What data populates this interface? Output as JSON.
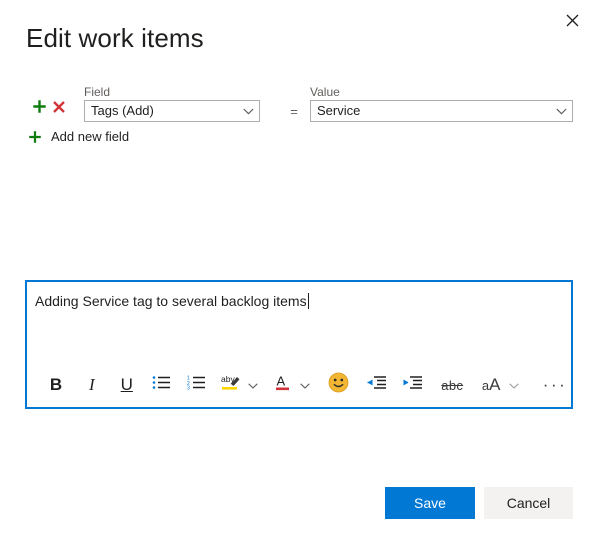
{
  "dialog": {
    "title": "Edit work items",
    "close_label": "Close"
  },
  "field_row": {
    "field_label": "Field",
    "value_label": "Value",
    "operator": "=",
    "field_selected": "Tags (Add)",
    "value_selected": "Service",
    "add_icon_name": "plus-icon",
    "remove_icon_name": "delete-icon"
  },
  "add_new_field": {
    "label": "Add new field"
  },
  "editor": {
    "text": "Adding Service tag to several backlog items",
    "toolbar": [
      {
        "name": "bold-icon",
        "label": "B",
        "kind": "bold"
      },
      {
        "name": "italic-icon",
        "label": "I",
        "kind": "italic"
      },
      {
        "name": "underline-icon",
        "label": "U",
        "kind": "underline"
      },
      {
        "name": "bulleted-list-icon",
        "label": "",
        "kind": "bullets"
      },
      {
        "name": "numbered-list-icon",
        "label": "",
        "kind": "numbers"
      },
      {
        "name": "highlight-icon",
        "label": "aby",
        "kind": "highlight"
      },
      {
        "name": "font-color-icon",
        "label": "A",
        "kind": "fontcolor"
      },
      {
        "name": "emoji-icon",
        "label": "",
        "kind": "emoji"
      },
      {
        "name": "decrease-indent-icon",
        "label": "",
        "kind": "outdent"
      },
      {
        "name": "increase-indent-icon",
        "label": "",
        "kind": "indent"
      },
      {
        "name": "strikethrough-icon",
        "label": "abc",
        "kind": "strike"
      },
      {
        "name": "font-size-icon",
        "label": "aA",
        "kind": "fontsize"
      },
      {
        "name": "more-options-icon",
        "label": "···",
        "kind": "more"
      }
    ]
  },
  "footer": {
    "save_label": "Save",
    "cancel_label": "Cancel"
  },
  "colors": {
    "accent": "#0078d4",
    "green": "#107c10",
    "red": "#d13438",
    "highlight_yellow": "#ffd400",
    "emoji_yellow": "#f2b632",
    "border": "#adadad",
    "cancel_bg": "#f3f2f1"
  }
}
